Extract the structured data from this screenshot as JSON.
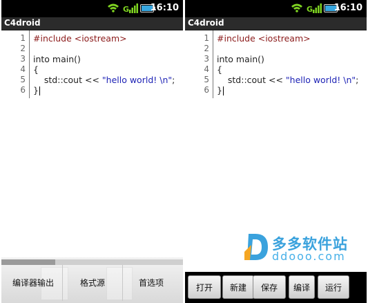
{
  "status": {
    "time": "16:10"
  },
  "app": {
    "title": "C4droid"
  },
  "code": {
    "lines": [
      {
        "num": "1",
        "text": "#include <iostream>"
      },
      {
        "num": "2",
        "text": ""
      },
      {
        "num": "3",
        "text": "into main()"
      },
      {
        "num": "4",
        "text": "{"
      },
      {
        "num": "5",
        "prefix": "    std::cout << ",
        "str": "\"hello world! \\n\"",
        "suffix": ";"
      },
      {
        "num": "6",
        "text": "}"
      }
    ]
  },
  "left_menu": {
    "items": [
      "编译器输出",
      "格式源",
      "首选项"
    ]
  },
  "toolbar": {
    "buttons": [
      "打开",
      "新建",
      "保存",
      "编译",
      "运行"
    ]
  },
  "watermark": {
    "cn": "多多软件站",
    "en": "ddooo.com"
  },
  "colors": {
    "directive": "#8b1a1a",
    "string": "#1d22b5",
    "watermark": "#3aa2dd"
  }
}
